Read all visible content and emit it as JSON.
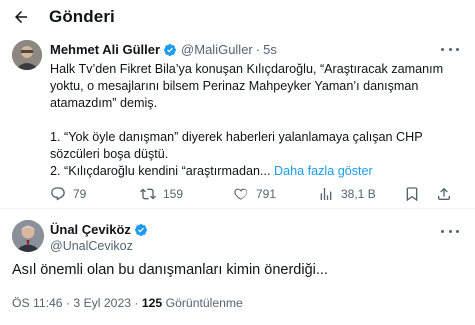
{
  "header": {
    "title": "Gönderi"
  },
  "quoted_tweet": {
    "author_name": "Mehmet Ali Güller",
    "handle": "@MaliGuller",
    "separator": "·",
    "time": "5s",
    "text_lines": [
      "Halk Tv’den Fikret Bila’ya konuşan Kılıçdaroğlu, “Araştıracak zamanım",
      "yoktu, o mesajlarını bilsem Perinaz Mahpeyker Yaman’ı danışman",
      "atamazdım” demiş.",
      "",
      "1. “Yok öyle danışman” diyerek haberleri yalanlamaya çalışan CHP",
      "sözcüleri boşa düştü.",
      "2. “Kılıçdaroğlu kendini “araştırmadan..."
    ],
    "show_more": "Daha fazla göster",
    "replies": "79",
    "reposts": "159",
    "likes": "791",
    "views": "38,1 B"
  },
  "main_tweet": {
    "author_name": "Ünal Çeviköz",
    "handle": "@UnalCevikoz",
    "text": "Asıl önemli olan bu danışmanları kimin önerdiği...",
    "timestamp": "ÖS 11:46 · 3 Eyl 2023 ·",
    "views_count": "125",
    "views_label": "Görüntülenme"
  },
  "colors": {
    "accent": "#1d9bf0",
    "secondary_text": "#536471",
    "repost_hint": "#536471"
  },
  "icons": [
    "back-arrow-icon",
    "verified-badge-icon",
    "more-icon",
    "reply-icon",
    "repost-icon",
    "like-icon",
    "views-icon",
    "bookmark-icon",
    "share-icon"
  ]
}
